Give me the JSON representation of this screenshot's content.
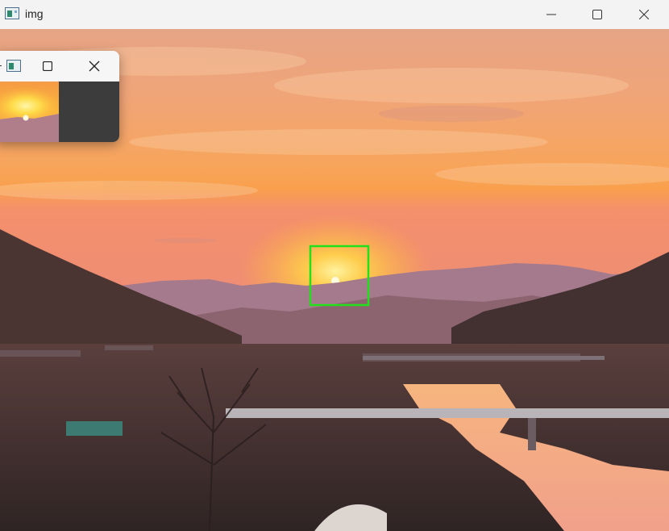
{
  "window": {
    "title": "img",
    "icon": "app-window-icon",
    "controls": [
      "minimize-icon",
      "maximize-icon",
      "close-icon"
    ]
  },
  "image": {
    "description_icon": "sunset-photo",
    "selection_box_color": "#22e01a"
  },
  "mini_window": {
    "controls": [
      "maximize-icon",
      "close-icon"
    ],
    "background_panel_color": "#3c3c3c"
  }
}
